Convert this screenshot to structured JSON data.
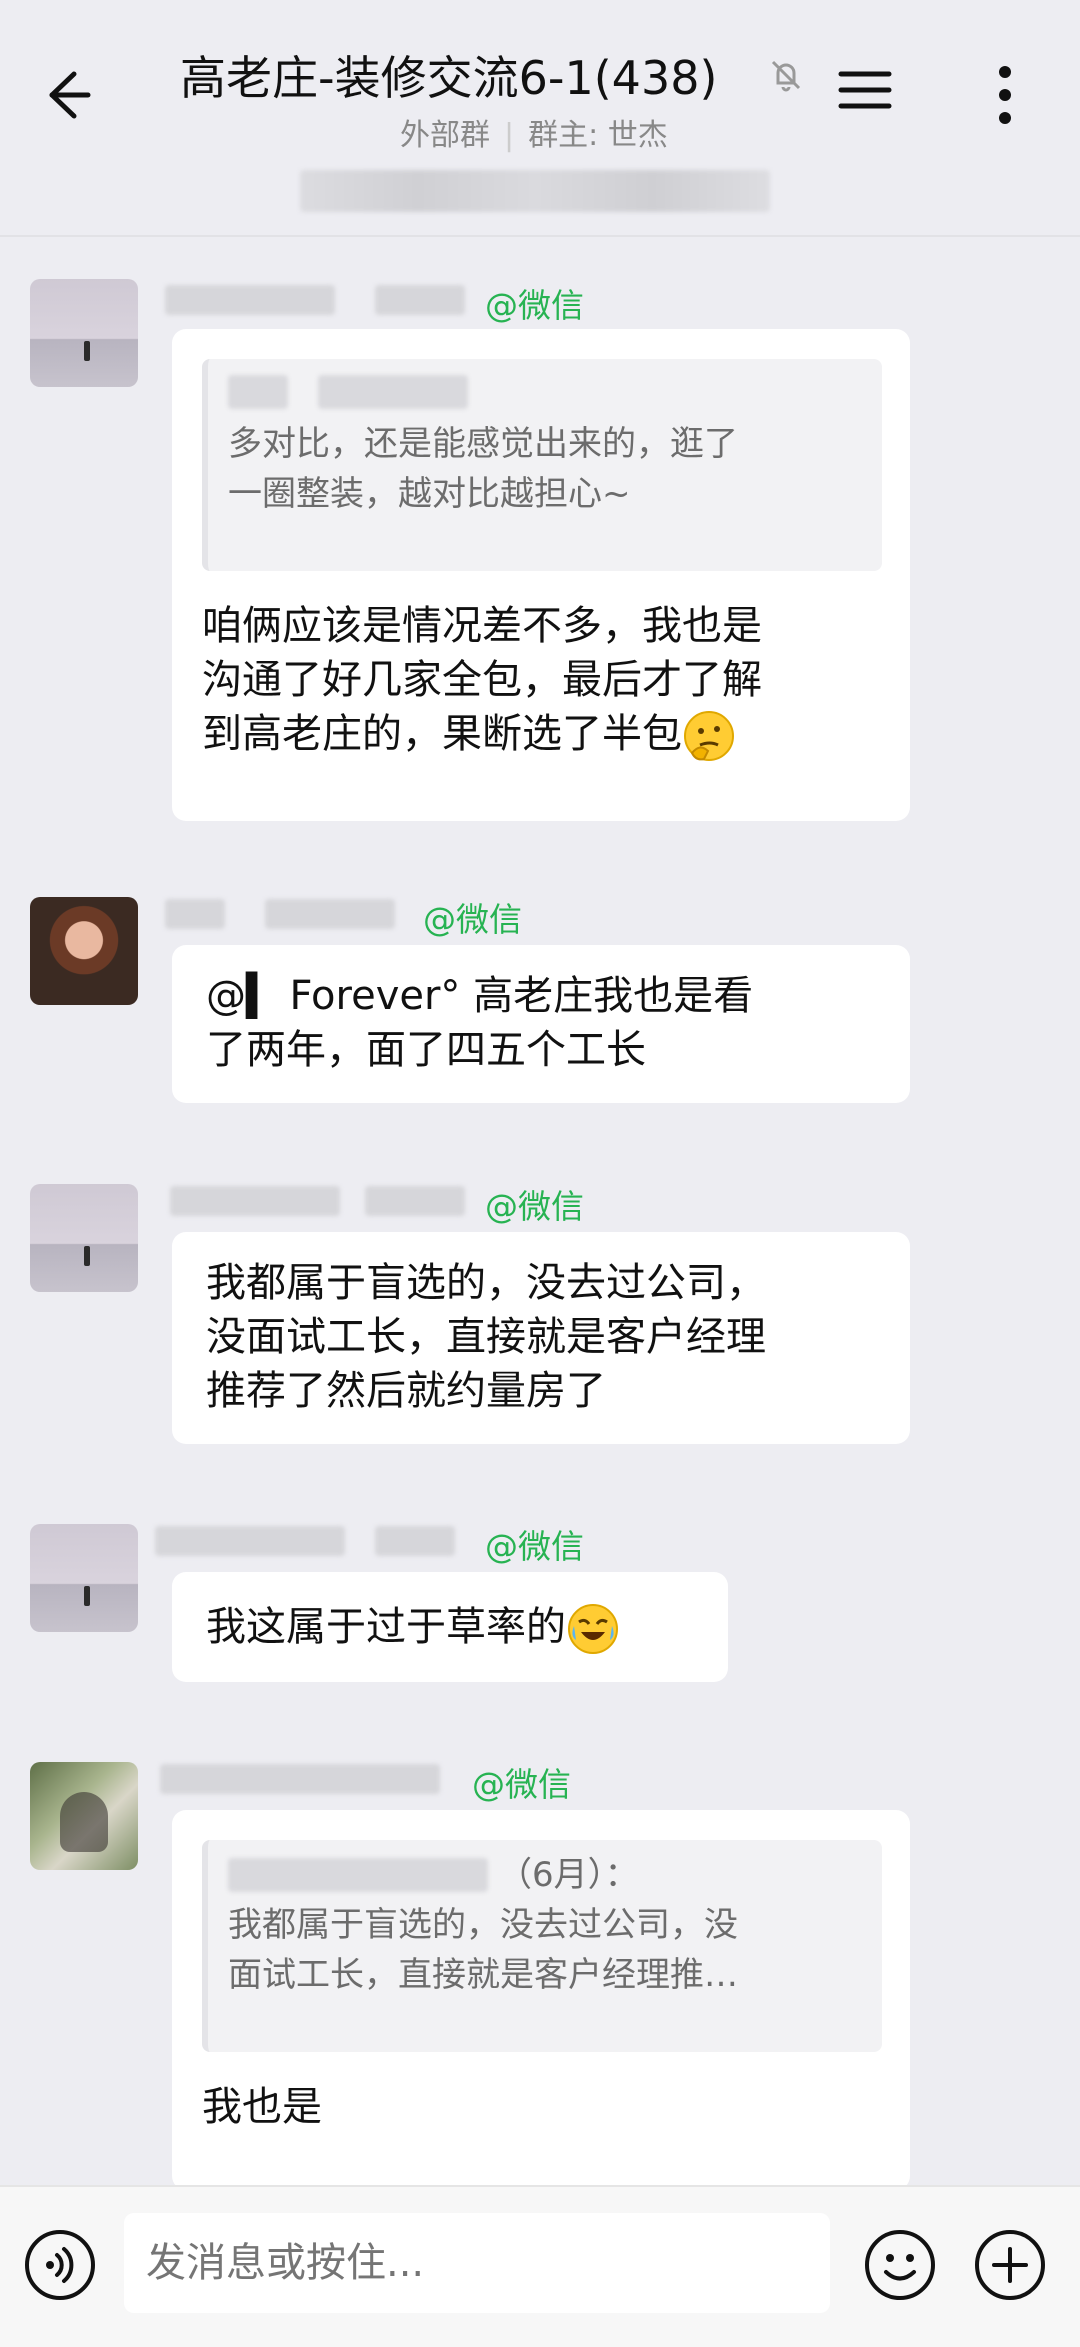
{
  "header": {
    "title": "高老庄-装修交流6-1(438)",
    "subtitle_left": "外部群",
    "subtitle_separator": "|",
    "subtitle_right": "群主: 世杰"
  },
  "messages": [
    {
      "tag": "@微信",
      "quote_text": "多对比，还是能感觉出来的，逛了一圈整装，越对比越担心~",
      "quote_line1": "多对比，还是能感觉出来的，逛了",
      "quote_line2": "一圈整装，越对比越担心~",
      "line1": "咱俩应该是情况差不多，我也是",
      "line2": "沟通了好几家全包，最后才了解",
      "line3": "到高老庄的，果断选了半包",
      "emoji": "thinking-face"
    },
    {
      "tag": "@微信",
      "mention": "@▍ Forever°",
      "line1_rest": "高老庄我也是看",
      "line2": "了两年，面了四五个工长"
    },
    {
      "tag": "@微信",
      "line1": "我都属于盲选的，没去过公司，",
      "line2": "没面试工长，直接就是客户经理",
      "line3": "推荐了然后就约量房了"
    },
    {
      "tag": "@微信",
      "line1": "我这属于过于草率的",
      "emoji": "rolling-laughing-face"
    },
    {
      "tag": "@微信",
      "quote_header": "（6月）：",
      "quote_line1": "我都属于盲选的，没去过公司，没",
      "quote_line2": "面试工长，直接就是客户经理推…",
      "line1": "我也是"
    }
  ],
  "input": {
    "placeholder": "发消息或按住..."
  }
}
